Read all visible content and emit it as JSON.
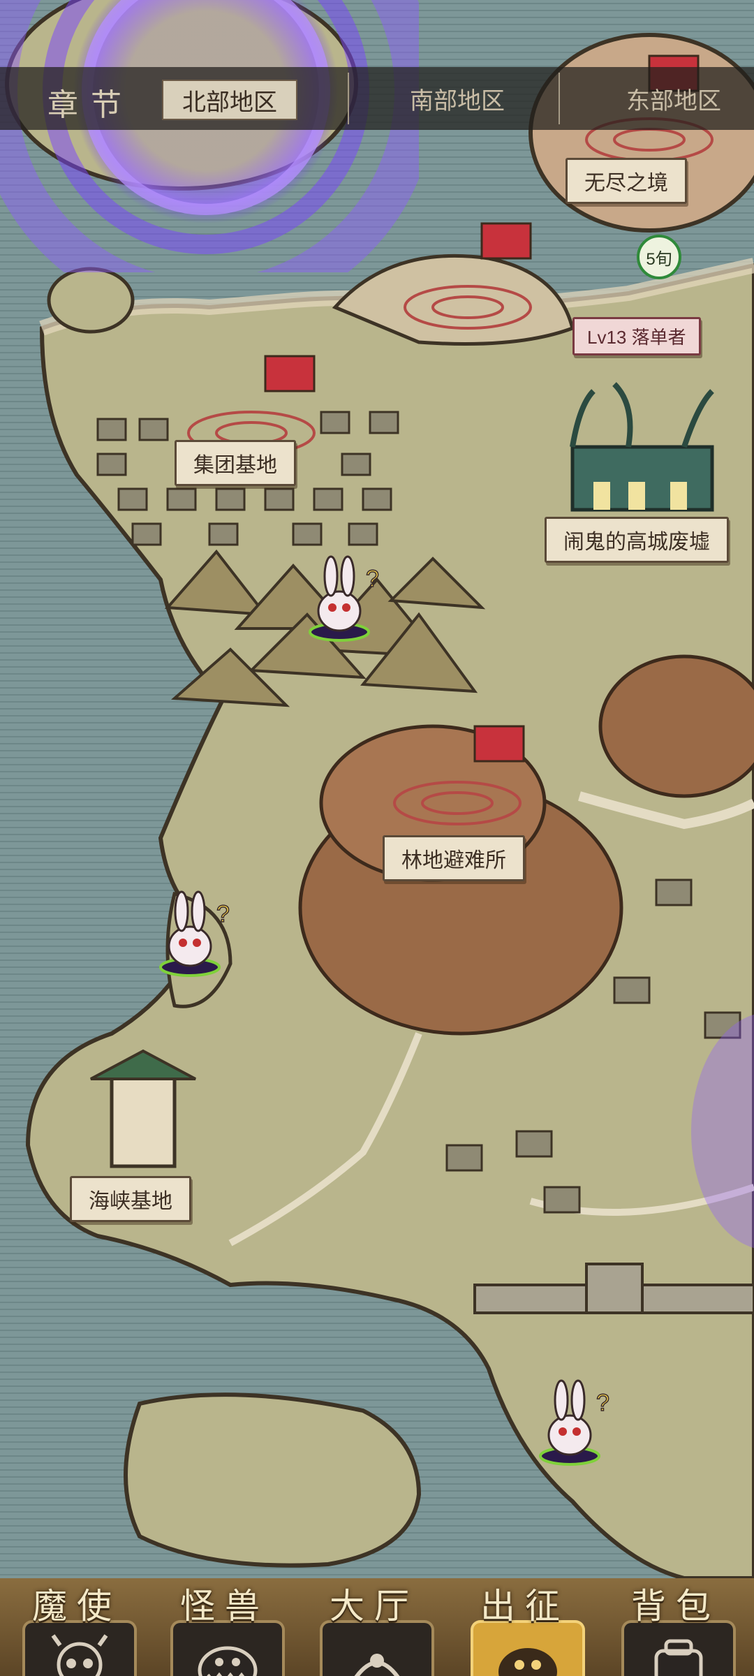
{
  "chapter": {
    "title": "章节",
    "tabs": [
      {
        "label": "北部地区",
        "active": true
      },
      {
        "label": "南部地区",
        "active": false
      },
      {
        "label": "东部地区",
        "active": false
      }
    ]
  },
  "locations": {
    "wuxian": "无尽之境",
    "jitan": "集团基地",
    "haunted": "闹鬼的高城废墟",
    "forest": "林地避难所",
    "strait": "海峡基地"
  },
  "enemy_camp": {
    "label": "Lv13 落单者",
    "turns": "5旬"
  },
  "nav": [
    {
      "label": "魔使",
      "icon": "demon-skull-icon",
      "active": false
    },
    {
      "label": "怪兽",
      "icon": "monster-icon",
      "active": false
    },
    {
      "label": "大厅",
      "icon": "hall-icon",
      "active": false
    },
    {
      "label": "出征",
      "icon": "expedition-icon",
      "active": true
    },
    {
      "label": "背包",
      "icon": "backpack-icon",
      "active": false
    }
  ],
  "colors": {
    "sea": "#6f8b8c",
    "land": "#b8b389",
    "active_nav": "#d7a53a",
    "portal": "#8f5bff",
    "flag": "#c8323c"
  }
}
